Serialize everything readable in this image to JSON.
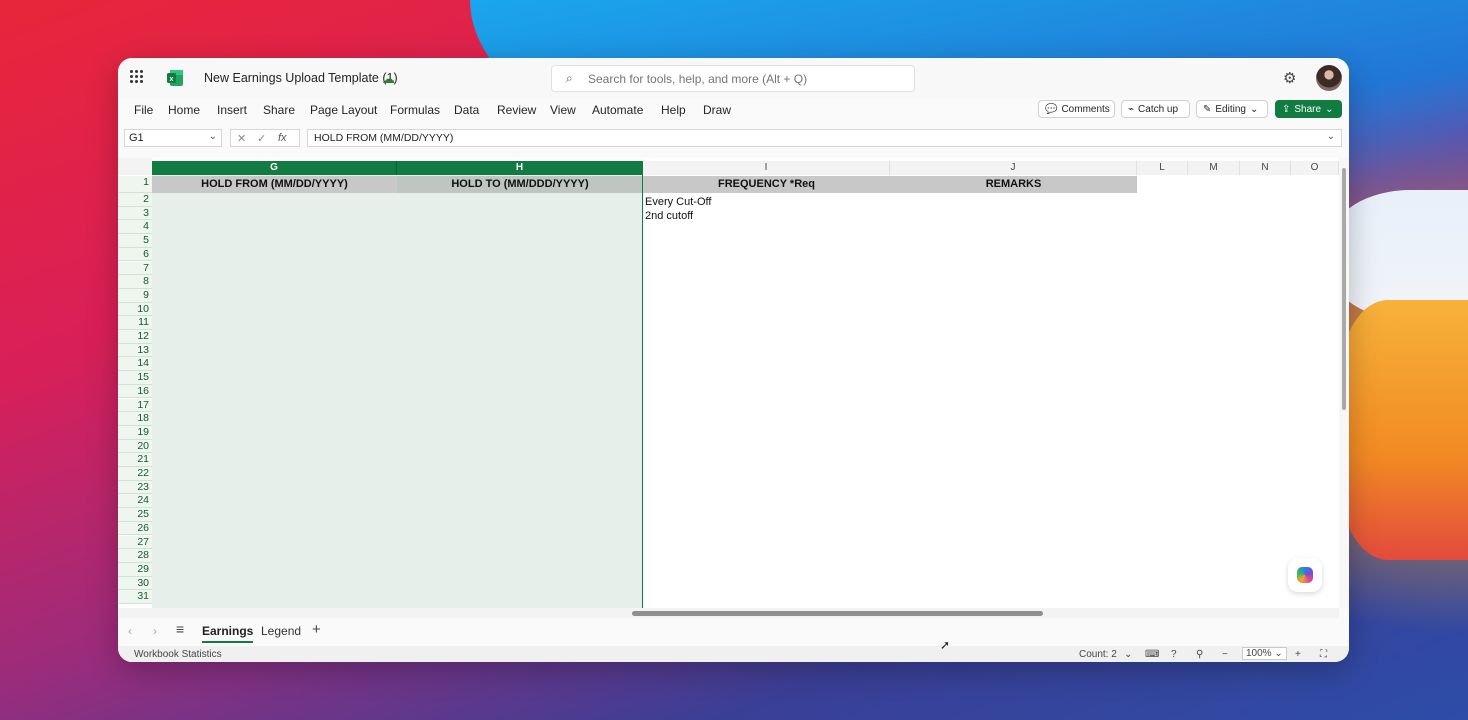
{
  "app": {
    "doc_title": "New Earnings Upload Template (1)",
    "search_placeholder": "Search for tools, help, and more (Alt + Q)"
  },
  "menu": [
    "File",
    "Home",
    "Insert",
    "Share",
    "Page Layout",
    "Formulas",
    "Data",
    "Review",
    "View",
    "Automate",
    "Help",
    "Draw"
  ],
  "ribbon_buttons": {
    "comments": "Comments",
    "catchup": "Catch up",
    "editing": "Editing",
    "share": "Share"
  },
  "formula_bar": {
    "name_box": "G1",
    "fx": "fx",
    "formula": "HOLD FROM (MM/DD/YYYY)"
  },
  "columns": [
    "G",
    "H",
    "I",
    "J",
    "L",
    "M",
    "N",
    "O"
  ],
  "header_row": {
    "G": "HOLD FROM (MM/DD/YYYY)",
    "H": "HOLD TO (MM/DDD/YYYY)",
    "I": "FREQUENCY *Req",
    "J": "REMARKS"
  },
  "cells": {
    "I2": "Every Cut-Off",
    "I3": "2nd cutoff"
  },
  "rows": [
    "1",
    "2",
    "3",
    "4",
    "5",
    "6",
    "7",
    "8",
    "9",
    "10",
    "11",
    "12",
    "13",
    "14",
    "15",
    "16",
    "17",
    "18",
    "19",
    "20",
    "21",
    "22",
    "23",
    "24",
    "25",
    "26",
    "27",
    "28",
    "29",
    "30",
    "31"
  ],
  "sheets": [
    "Earnings",
    "Legend"
  ],
  "active_sheet": "Earnings",
  "status": {
    "left": "Workbook Statistics",
    "count": "Count: 2",
    "zoom": "100%"
  },
  "colors": {
    "accent": "#107c41",
    "header_fill": "#c8c8c8",
    "selection_fill": "#e6efea"
  }
}
